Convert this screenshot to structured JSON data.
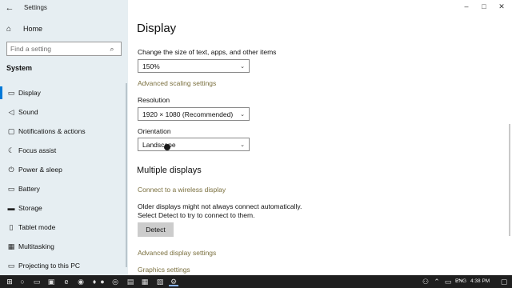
{
  "window": {
    "title": "Settings",
    "back_glyph": "←",
    "minimize_glyph": "–",
    "maximize_glyph": "□",
    "close_glyph": "✕"
  },
  "sidebar": {
    "home_label": "Home",
    "home_icon": "⌂",
    "search_placeholder": "Find a setting",
    "search_icon": "⌕",
    "section_title": "System",
    "items": [
      {
        "label": "Display",
        "icon": "▭"
      },
      {
        "label": "Sound",
        "icon": "◁"
      },
      {
        "label": "Notifications & actions",
        "icon": "▢"
      },
      {
        "label": "Focus assist",
        "icon": "☾"
      },
      {
        "label": "Power & sleep",
        "icon": "⏻"
      },
      {
        "label": "Battery",
        "icon": "▭"
      },
      {
        "label": "Storage",
        "icon": "▬"
      },
      {
        "label": "Tablet mode",
        "icon": "▯"
      },
      {
        "label": "Multitasking",
        "icon": "▦"
      },
      {
        "label": "Projecting to this PC",
        "icon": "▭"
      }
    ]
  },
  "main": {
    "title": "Display",
    "scale_label": "Change the size of text, apps, and other items",
    "scale_value": "150%",
    "advanced_scaling_link": "Advanced scaling settings",
    "resolution_label": "Resolution",
    "resolution_value": "1920 × 1080 (Recommended)",
    "orientation_label": "Orientation",
    "orientation_value": "Landscape",
    "multiple_displays_heading": "Multiple displays",
    "wireless_link": "Connect to a wireless display",
    "detect_line1": "Older displays might not always connect automatically.",
    "detect_line2": "Select Detect to try to connect to them.",
    "detect_button": "Detect",
    "advanced_display_link": "Advanced display settings",
    "graphics_link": "Graphics settings",
    "dropdown_chevron": "⌄"
  },
  "taskbar": {
    "language": "ENG",
    "time": "4:38 PM",
    "accent_color": "#0078d7"
  }
}
